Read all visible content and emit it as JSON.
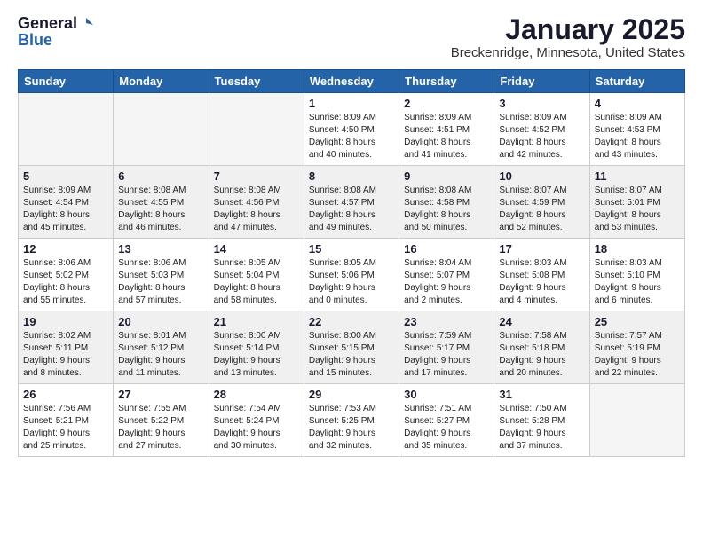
{
  "header": {
    "logo_general": "General",
    "logo_blue": "Blue",
    "title": "January 2025",
    "subtitle": "Breckenridge, Minnesota, United States"
  },
  "calendar": {
    "days_of_week": [
      "Sunday",
      "Monday",
      "Tuesday",
      "Wednesday",
      "Thursday",
      "Friday",
      "Saturday"
    ],
    "weeks": [
      [
        {
          "day": "",
          "empty": true
        },
        {
          "day": "",
          "empty": true
        },
        {
          "day": "",
          "empty": true
        },
        {
          "day": "1",
          "info": "Sunrise: 8:09 AM\nSunset: 4:50 PM\nDaylight: 8 hours\nand 40 minutes."
        },
        {
          "day": "2",
          "info": "Sunrise: 8:09 AM\nSunset: 4:51 PM\nDaylight: 8 hours\nand 41 minutes."
        },
        {
          "day": "3",
          "info": "Sunrise: 8:09 AM\nSunset: 4:52 PM\nDaylight: 8 hours\nand 42 minutes."
        },
        {
          "day": "4",
          "info": "Sunrise: 8:09 AM\nSunset: 4:53 PM\nDaylight: 8 hours\nand 43 minutes."
        }
      ],
      [
        {
          "day": "5",
          "info": "Sunrise: 8:09 AM\nSunset: 4:54 PM\nDaylight: 8 hours\nand 45 minutes."
        },
        {
          "day": "6",
          "info": "Sunrise: 8:08 AM\nSunset: 4:55 PM\nDaylight: 8 hours\nand 46 minutes."
        },
        {
          "day": "7",
          "info": "Sunrise: 8:08 AM\nSunset: 4:56 PM\nDaylight: 8 hours\nand 47 minutes."
        },
        {
          "day": "8",
          "info": "Sunrise: 8:08 AM\nSunset: 4:57 PM\nDaylight: 8 hours\nand 49 minutes."
        },
        {
          "day": "9",
          "info": "Sunrise: 8:08 AM\nSunset: 4:58 PM\nDaylight: 8 hours\nand 50 minutes."
        },
        {
          "day": "10",
          "info": "Sunrise: 8:07 AM\nSunset: 4:59 PM\nDaylight: 8 hours\nand 52 minutes."
        },
        {
          "day": "11",
          "info": "Sunrise: 8:07 AM\nSunset: 5:01 PM\nDaylight: 8 hours\nand 53 minutes."
        }
      ],
      [
        {
          "day": "12",
          "info": "Sunrise: 8:06 AM\nSunset: 5:02 PM\nDaylight: 8 hours\nand 55 minutes."
        },
        {
          "day": "13",
          "info": "Sunrise: 8:06 AM\nSunset: 5:03 PM\nDaylight: 8 hours\nand 57 minutes."
        },
        {
          "day": "14",
          "info": "Sunrise: 8:05 AM\nSunset: 5:04 PM\nDaylight: 8 hours\nand 58 minutes."
        },
        {
          "day": "15",
          "info": "Sunrise: 8:05 AM\nSunset: 5:06 PM\nDaylight: 9 hours\nand 0 minutes."
        },
        {
          "day": "16",
          "info": "Sunrise: 8:04 AM\nSunset: 5:07 PM\nDaylight: 9 hours\nand 2 minutes."
        },
        {
          "day": "17",
          "info": "Sunrise: 8:03 AM\nSunset: 5:08 PM\nDaylight: 9 hours\nand 4 minutes."
        },
        {
          "day": "18",
          "info": "Sunrise: 8:03 AM\nSunset: 5:10 PM\nDaylight: 9 hours\nand 6 minutes."
        }
      ],
      [
        {
          "day": "19",
          "info": "Sunrise: 8:02 AM\nSunset: 5:11 PM\nDaylight: 9 hours\nand 8 minutes."
        },
        {
          "day": "20",
          "info": "Sunrise: 8:01 AM\nSunset: 5:12 PM\nDaylight: 9 hours\nand 11 minutes."
        },
        {
          "day": "21",
          "info": "Sunrise: 8:00 AM\nSunset: 5:14 PM\nDaylight: 9 hours\nand 13 minutes."
        },
        {
          "day": "22",
          "info": "Sunrise: 8:00 AM\nSunset: 5:15 PM\nDaylight: 9 hours\nand 15 minutes."
        },
        {
          "day": "23",
          "info": "Sunrise: 7:59 AM\nSunset: 5:17 PM\nDaylight: 9 hours\nand 17 minutes."
        },
        {
          "day": "24",
          "info": "Sunrise: 7:58 AM\nSunset: 5:18 PM\nDaylight: 9 hours\nand 20 minutes."
        },
        {
          "day": "25",
          "info": "Sunrise: 7:57 AM\nSunset: 5:19 PM\nDaylight: 9 hours\nand 22 minutes."
        }
      ],
      [
        {
          "day": "26",
          "info": "Sunrise: 7:56 AM\nSunset: 5:21 PM\nDaylight: 9 hours\nand 25 minutes."
        },
        {
          "day": "27",
          "info": "Sunrise: 7:55 AM\nSunset: 5:22 PM\nDaylight: 9 hours\nand 27 minutes."
        },
        {
          "day": "28",
          "info": "Sunrise: 7:54 AM\nSunset: 5:24 PM\nDaylight: 9 hours\nand 30 minutes."
        },
        {
          "day": "29",
          "info": "Sunrise: 7:53 AM\nSunset: 5:25 PM\nDaylight: 9 hours\nand 32 minutes."
        },
        {
          "day": "30",
          "info": "Sunrise: 7:51 AM\nSunset: 5:27 PM\nDaylight: 9 hours\nand 35 minutes."
        },
        {
          "day": "31",
          "info": "Sunrise: 7:50 AM\nSunset: 5:28 PM\nDaylight: 9 hours\nand 37 minutes."
        },
        {
          "day": "",
          "empty": true
        }
      ]
    ]
  }
}
